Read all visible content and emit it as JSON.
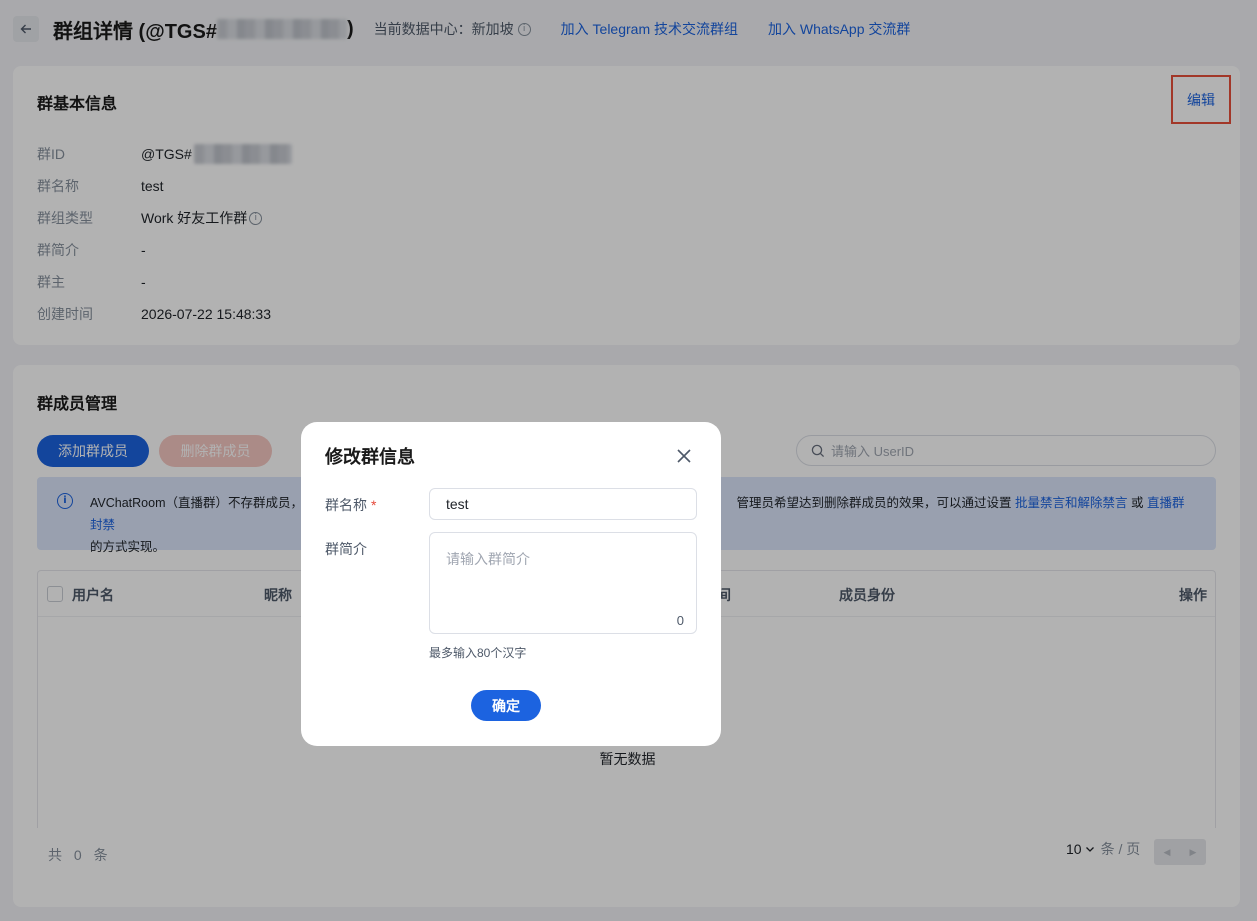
{
  "header": {
    "title_prefix": "群组详情 (@TGS#",
    "title_suffix": ")",
    "datacenter_label": "当前数据中心：新加坡",
    "telegram_link": "加入 Telegram 技术交流群组",
    "whatsapp_link": "加入 WhatsApp 交流群"
  },
  "basic_info": {
    "title": "群基本信息",
    "edit_label": "编辑",
    "rows": [
      {
        "label": "群ID",
        "value": "@TGS#"
      },
      {
        "label": "群名称",
        "value": "test"
      },
      {
        "label": "群组类型",
        "value": "Work 好友工作群"
      },
      {
        "label": "群简介",
        "value": "-"
      },
      {
        "label": "群主",
        "value": "-"
      },
      {
        "label": "创建时间",
        "value": "2026-07-22 15:48:33"
      }
    ]
  },
  "members": {
    "title": "群成员管理",
    "add_button": "添加群成员",
    "delete_button": "删除群成员",
    "search_placeholder": "请输入 UserID",
    "notice_part1": "AVChatRoom（直播群）不存群成员，不",
    "notice_part2": "管理员希望达到删除群成员的效果，可以通过设置 ",
    "notice_link1": "批量禁言和解除禁言",
    "notice_or": " 或 ",
    "notice_link2": "直播群封禁",
    "notice_line2": "的方式实现。",
    "columns": {
      "username": "用户名",
      "nickname": "昵称",
      "time_partial": "间",
      "role": "成员身份",
      "action": "操作"
    },
    "empty_text": "暂无数据",
    "total_text": "共 0 条",
    "page_size": "10",
    "page_unit": "条 / 页"
  },
  "modal": {
    "title": "修改群信息",
    "name_label": "群名称",
    "required_mark": "*",
    "name_value": "test",
    "intro_label": "群简介",
    "intro_placeholder": "请输入群简介",
    "intro_count": "0",
    "hint": "最多输入80个汉字",
    "confirm_button": "确定"
  },
  "colors": {
    "primary": "#1c63e0",
    "danger_disabled": "#f5c7c2",
    "highlight_border": "#e8503a"
  }
}
